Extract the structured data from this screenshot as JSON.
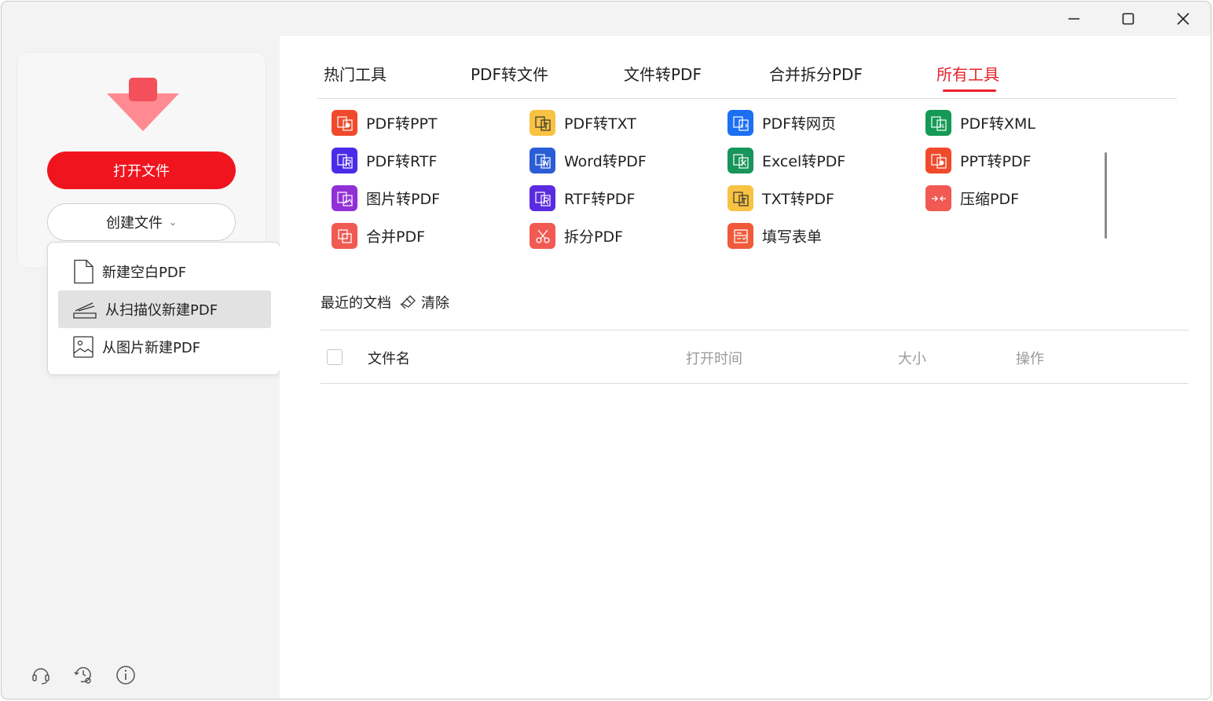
{
  "colors": {
    "accent": "#e8202a",
    "primary_button": "#f0141e"
  },
  "sidebar": {
    "open_button": "打开文件",
    "create_button": "创建文件",
    "create_menu": [
      {
        "label": "新建空白PDF",
        "icon": "blank-document-icon"
      },
      {
        "label": "从扫描仪新建PDF",
        "icon": "scanner-icon",
        "highlighted": true
      },
      {
        "label": "从图片新建PDF",
        "icon": "image-icon"
      }
    ],
    "bottom_icons": [
      "support-headset-icon",
      "history-settings-icon",
      "info-icon"
    ]
  },
  "tabs": [
    {
      "label": "热门工具"
    },
    {
      "label": "PDF转文件"
    },
    {
      "label": "文件转PDF"
    },
    {
      "label": "合并拆分PDF"
    },
    {
      "label": "所有工具",
      "active": true
    }
  ],
  "tools": [
    {
      "label": "PDF转PPT",
      "color": "#f04a2c",
      "icon": "pdf-to-ppt-icon"
    },
    {
      "label": "PDF转TXT",
      "color": "#f8c243",
      "icon": "pdf-to-txt-icon"
    },
    {
      "label": "PDF转网页",
      "color": "#1d6ff2",
      "icon": "pdf-to-web-icon"
    },
    {
      "label": "PDF转XML",
      "color": "#159a55",
      "icon": "pdf-to-xml-icon"
    },
    {
      "label": "PDF转RTF",
      "color": "#4a2ce8",
      "icon": "pdf-to-rtf-icon"
    },
    {
      "label": "Word转PDF",
      "color": "#2a5dd6",
      "icon": "word-to-pdf-icon"
    },
    {
      "label": "Excel转PDF",
      "color": "#17955a",
      "icon": "excel-to-pdf-icon"
    },
    {
      "label": "PPT转PDF",
      "color": "#f04a2c",
      "icon": "ppt-to-pdf-icon"
    },
    {
      "label": "图片转PDF",
      "color": "#9230d8",
      "icon": "image-to-pdf-icon"
    },
    {
      "label": "RTF转PDF",
      "color": "#5a2be0",
      "icon": "rtf-to-pdf-icon"
    },
    {
      "label": "TXT转PDF",
      "color": "#f8c243",
      "icon": "txt-to-pdf-icon"
    },
    {
      "label": "压缩PDF",
      "color": "#f05a52",
      "icon": "compress-icon"
    },
    {
      "label": "合并PDF",
      "color": "#f05a52",
      "icon": "merge-icon"
    },
    {
      "label": "拆分PDF",
      "color": "#f05a52",
      "icon": "split-icon"
    },
    {
      "label": "填写表单",
      "color": "#f05a3a",
      "icon": "form-icon"
    }
  ],
  "recent": {
    "title": "最近的文档",
    "clear": "清除"
  },
  "table": {
    "columns": [
      "文件名",
      "打开时间",
      "大小",
      "操作"
    ]
  }
}
